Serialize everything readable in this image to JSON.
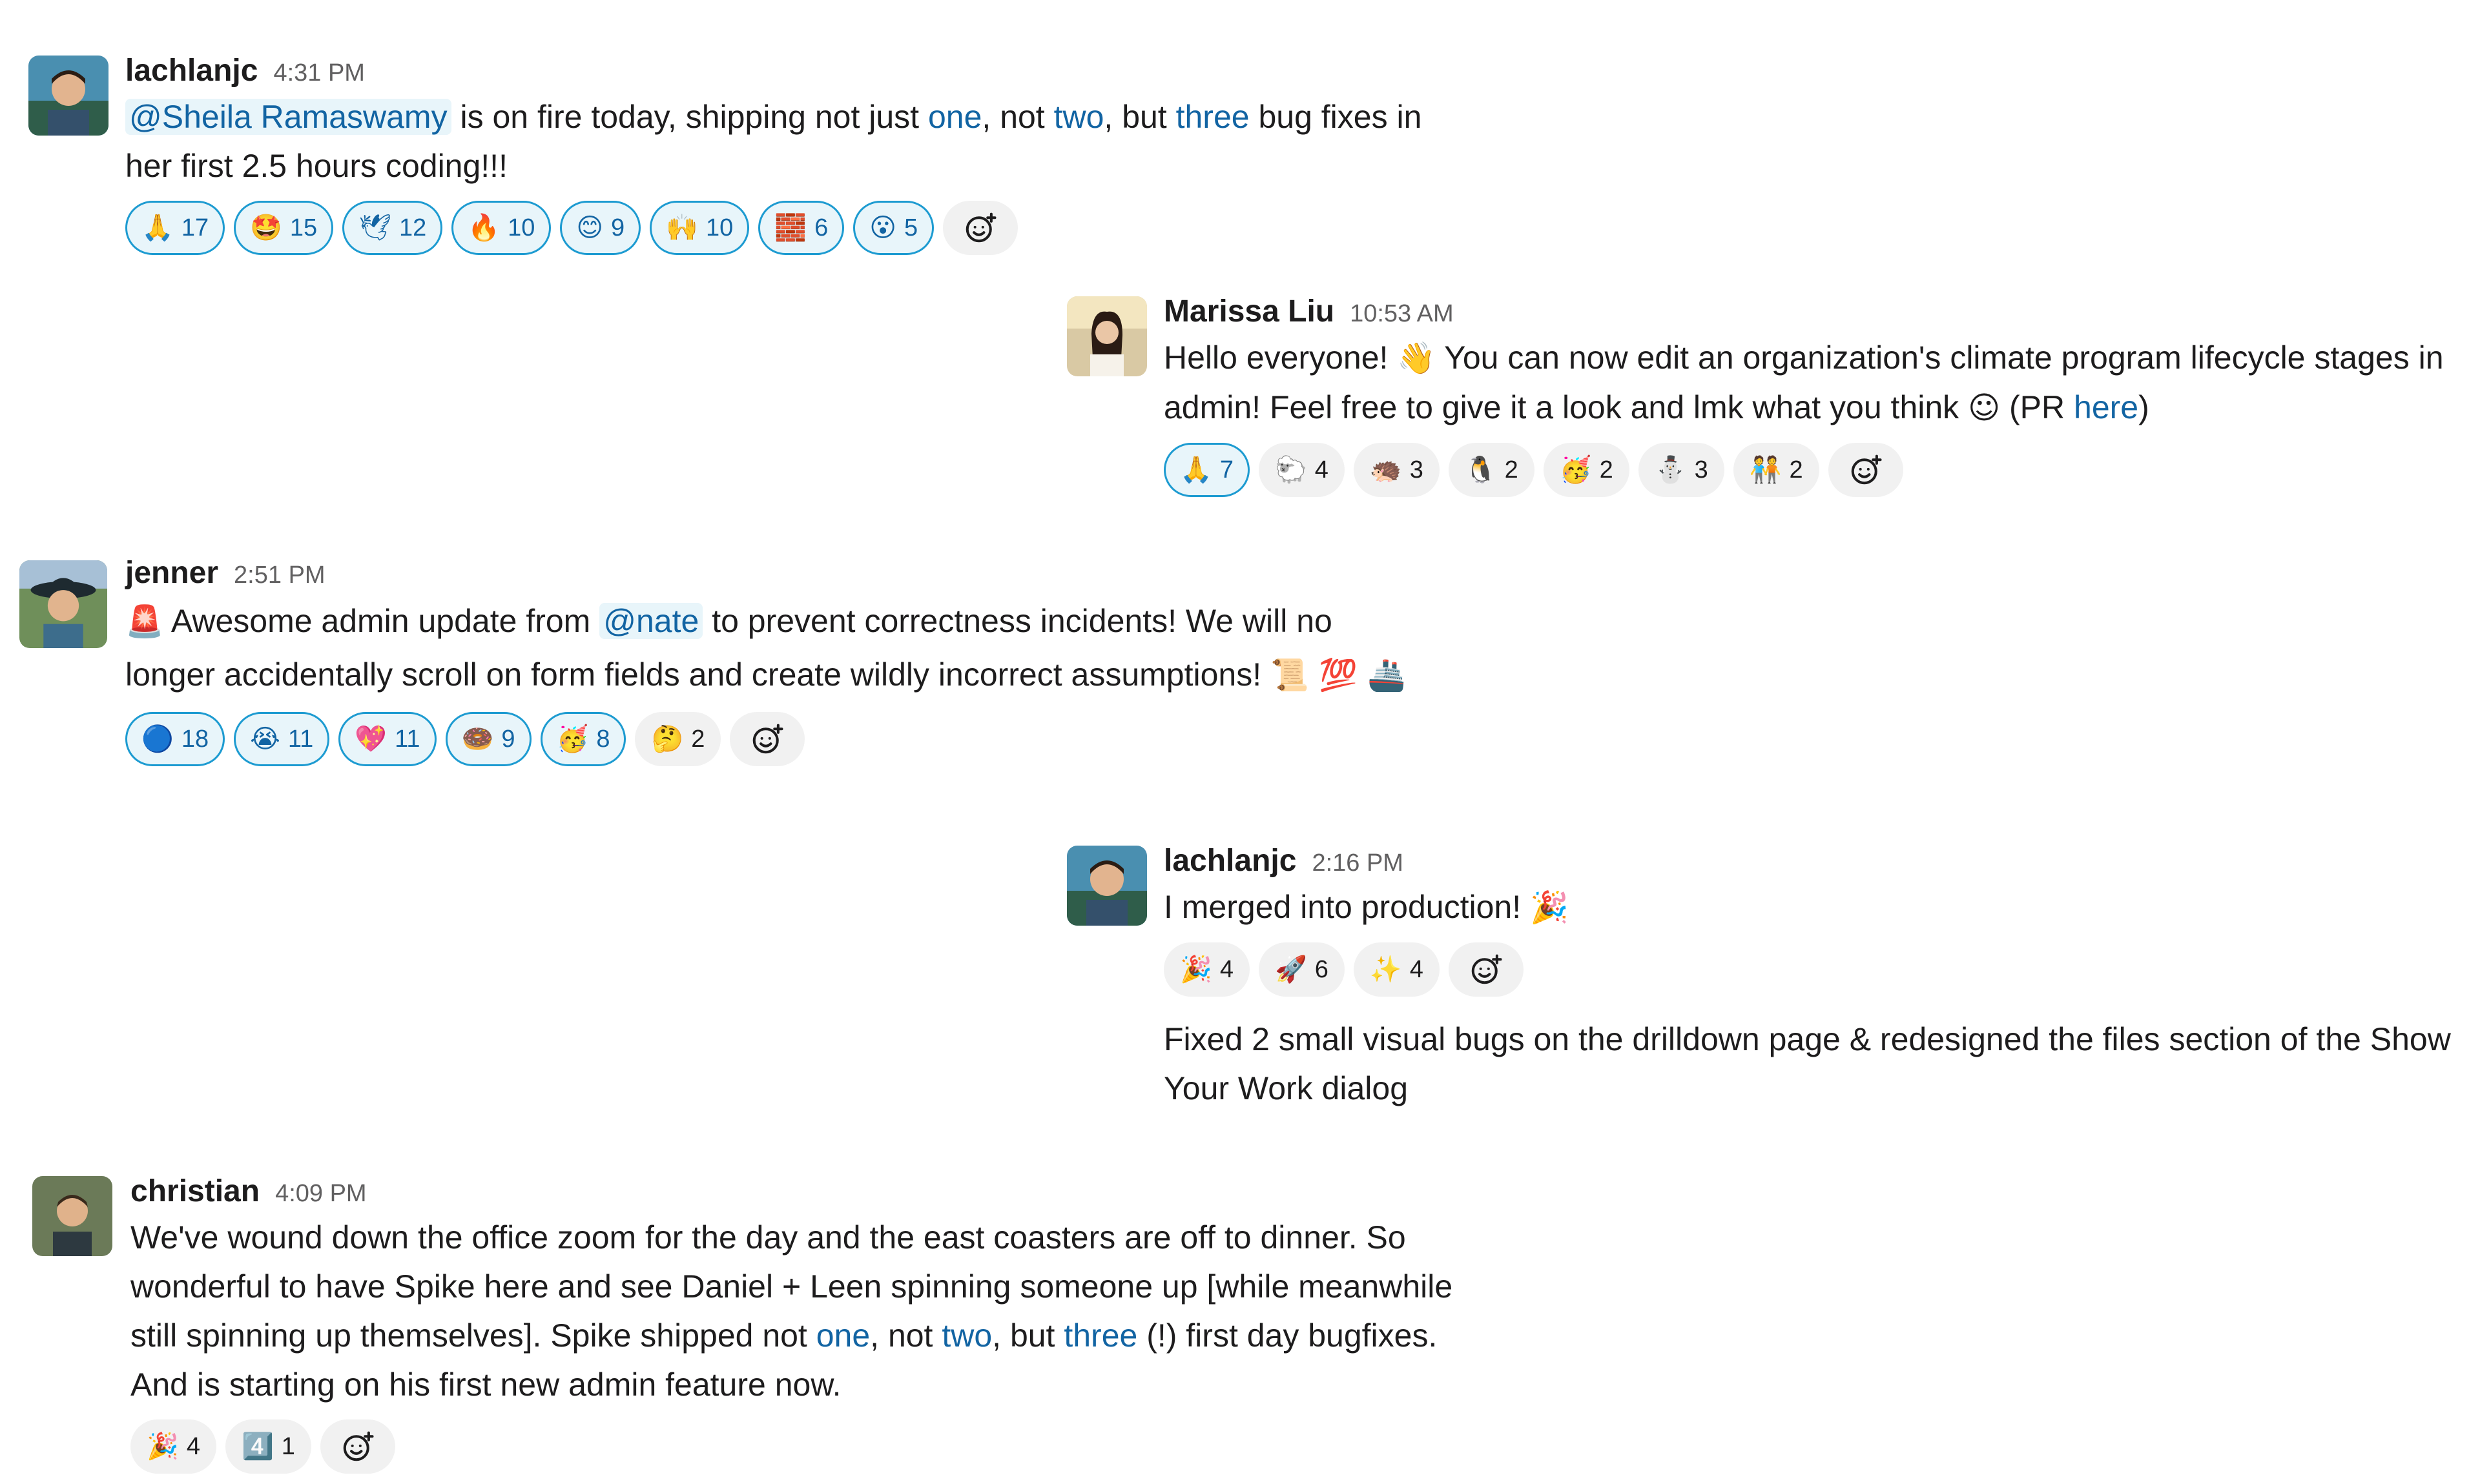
{
  "messages": [
    {
      "author": "lachlanjc",
      "time": "4:31 PM",
      "mention": "@Sheila Ramaswamy",
      "line1_a": " is on fire today, shipping not just ",
      "one": "one",
      "comma1": ", not ",
      "two": "two",
      "comma2": ", but ",
      "three": "three",
      "line1_b": " bug fixes in",
      "line2": "her first 2.5 hours coding!!!",
      "reactions": [
        {
          "icon": "🙏",
          "count": "17",
          "mine": true
        },
        {
          "icon": "🤩",
          "count": "15",
          "mine": true
        },
        {
          "icon": "🕊",
          "count": "12",
          "mine": true
        },
        {
          "icon": "🔥",
          "count": "10",
          "mine": true
        },
        {
          "icon": "😊",
          "count": "9",
          "mine": true
        },
        {
          "icon": "🙌",
          "count": "10",
          "mine": true
        },
        {
          "icon": "🧱",
          "count": "6",
          "mine": true
        },
        {
          "icon": "😮",
          "count": "5",
          "mine": true
        }
      ]
    },
    {
      "author": "Marissa Liu",
      "time": "10:53 AM",
      "line1_a": "Hello everyone! ",
      "wave": "👋",
      "line1_b": " You can now edit an organization's climate program lifecycle stages in",
      "line2_a": "admin! Feel free to give it a look and lmk what you think ",
      "smile": "☺",
      "line2_b": " (PR ",
      "here": "here",
      "line2_c": ")",
      "reactions": [
        {
          "icon": "🙏",
          "count": "7",
          "mine": true
        },
        {
          "icon": "🐑",
          "count": "4",
          "mine": false
        },
        {
          "icon": "🦔",
          "count": "3",
          "mine": false
        },
        {
          "icon": "🐧",
          "count": "2",
          "mine": false
        },
        {
          "icon": "🥳",
          "count": "2",
          "mine": false
        },
        {
          "icon": "⛄",
          "count": "3",
          "mine": false
        },
        {
          "icon": "🧑‍🤝‍🧑",
          "count": "2",
          "mine": false
        }
      ]
    },
    {
      "author": "jenner",
      "time": "2:51 PM",
      "siren": "🚨",
      "line1_a": " Awesome admin update from ",
      "mention": "@nate",
      "line1_b": " to prevent correctness incidents! We will no",
      "line2": "longer accidentally scroll on form fields and create wildly incorrect assumptions! ",
      "trail_emojis": "📜 💯 🚢",
      "reactions": [
        {
          "icon": "🔵",
          "count": "18",
          "mine": true
        },
        {
          "icon": "😭",
          "count": "11",
          "mine": true
        },
        {
          "icon": "💖",
          "count": "11",
          "mine": true
        },
        {
          "icon": "🍩",
          "count": "9",
          "mine": true
        },
        {
          "icon": "🥳",
          "count": "8",
          "mine": true
        },
        {
          "icon": "🤔",
          "count": "2",
          "mine": false
        }
      ]
    },
    {
      "author": "lachlanjc",
      "time": "2:16 PM",
      "line1": "I merged into production! ",
      "party": "🎉",
      "reactions": [
        {
          "icon": "🎉",
          "count": "4",
          "mine": false
        },
        {
          "icon": "🚀",
          "count": "6",
          "mine": false
        },
        {
          "icon": "✨",
          "count": "4",
          "mine": false
        }
      ],
      "followup_1": "Fixed 2 small visual bugs on the drilldown page & redesigned the files section of the Show",
      "followup_2": "Your Work dialog"
    },
    {
      "author": "christian",
      "time": "4:09 PM",
      "line1": "We've wound down the office zoom for the day and the east coasters are off to dinner. So",
      "line2": "wonderful to have Spike here and see Daniel + Leen spinning someone up [while meanwhile",
      "line3_a": "still spinning up themselves]. Spike shipped not ",
      "one": "one",
      "comma1": ", not ",
      "two": "two",
      "comma2": ", but ",
      "three": "three",
      "line3_b": " (!) first day bugfixes.",
      "line4": "And is starting on his first new admin feature now.",
      "reactions": [
        {
          "icon": "🎉",
          "count": "4",
          "mine": false
        },
        {
          "icon": "4️⃣",
          "count": "1",
          "mine": false
        }
      ]
    }
  ],
  "add_reaction_icon": "add-reaction-icon"
}
